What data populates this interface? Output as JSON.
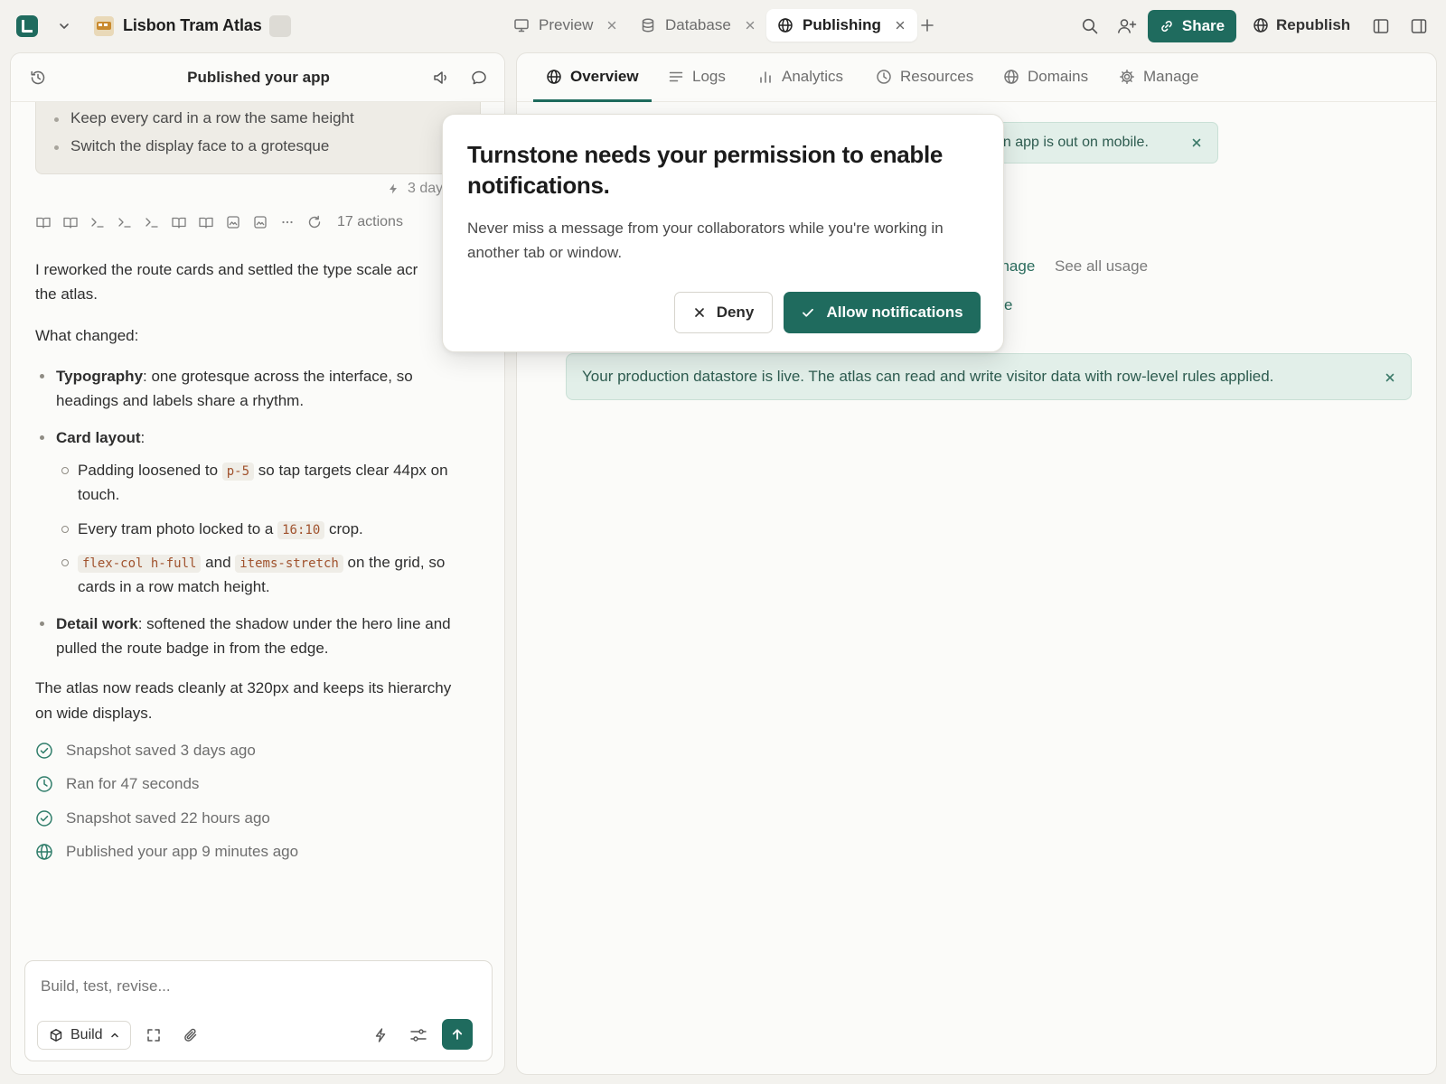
{
  "header": {
    "project_title": "Lisbon Tram Atlas",
    "tabs": [
      {
        "label": "Preview",
        "icon": "monitor-icon",
        "active": false
      },
      {
        "label": "Database",
        "icon": "database-icon",
        "active": false
      },
      {
        "label": "Publishing",
        "icon": "globe-icon",
        "active": true
      }
    ],
    "share_label": "Share",
    "republish_label": "Republish"
  },
  "chat": {
    "title": "Published your app",
    "quote_items": [
      "Keep every card in a row the same height",
      "Switch the display face to a grotesque"
    ],
    "quote_time": "3 day",
    "actions_count": "17 actions",
    "intro": "I reworked the route cards and settled the type scale acr",
    "intro_cont": "the atlas.",
    "what_changed": "What changed:",
    "bullets": {
      "typography_label": "Typography",
      "typography_text": ": one grotesque across the interface, so",
      "typography_cont": "headings and labels share a rhythm.",
      "card_label": "Card layout",
      "card_colon": ":",
      "sub1_a": "Padding loosened to ",
      "sub1_code": "p-5",
      "sub1_b": " so tap targets clear 44px on",
      "sub1_cont": "touch.",
      "sub2_a": "Every tram photo locked to a ",
      "sub2_code": "16:10",
      "sub2_b": " crop.",
      "sub3_code1": "flex-col h-full",
      "sub3_and": " and ",
      "sub3_code2": "items-stretch",
      "sub3_b": " on the grid, so",
      "sub3_cont": "cards in a row match height.",
      "detail_label": "Detail work",
      "detail_text": ": softened the shadow under the hero line and",
      "detail_cont": "pulled the route badge in from the edge."
    },
    "closing_1": "The atlas now reads cleanly at 320px and keeps its hierarchy",
    "closing_2": "on wide displays.",
    "status": [
      {
        "icon": "check-circle-icon",
        "text": "Snapshot saved 3 days ago"
      },
      {
        "icon": "clock-icon",
        "text": "Ran for 47 seconds"
      },
      {
        "icon": "check-circle-icon",
        "text": "Snapshot saved 22 hours ago"
      },
      {
        "icon": "globe-icon",
        "text": "Published your app 9 minutes ago"
      }
    ],
    "composer_placeholder": "Build, test, revise...",
    "build_label": "Build"
  },
  "publishing": {
    "tabs": [
      {
        "label": "Overview",
        "icon": "globe-icon",
        "active": true
      },
      {
        "label": "Logs",
        "icon": "lines-icon",
        "active": false
      },
      {
        "label": "Analytics",
        "icon": "bar-chart-icon",
        "active": false
      },
      {
        "label": "Resources",
        "icon": "clock-icon",
        "active": false
      },
      {
        "label": "Domains",
        "icon": "globe-icon",
        "active": false
      },
      {
        "label": "Manage",
        "icon": "gear-icon",
        "active": false
      }
    ],
    "mobile_banner": "on app is out on mobile.",
    "usage_manage": "anage",
    "usage_see_all": "See all usage",
    "usage_partial": "e",
    "datastore_banner": "Your production datastore is live. The atlas can read and write visitor data with row-level rules applied."
  },
  "modal": {
    "title": "Turnstone needs your permission to enable notifications.",
    "body": "Never miss a message from your collaborators while you're working in another tab or window.",
    "deny_label": "Deny",
    "allow_label": "Allow notifications"
  },
  "colors": {
    "accent": "#1f6b5e",
    "banner_bg": "#e2efe9",
    "background": "#f3f2ee"
  }
}
